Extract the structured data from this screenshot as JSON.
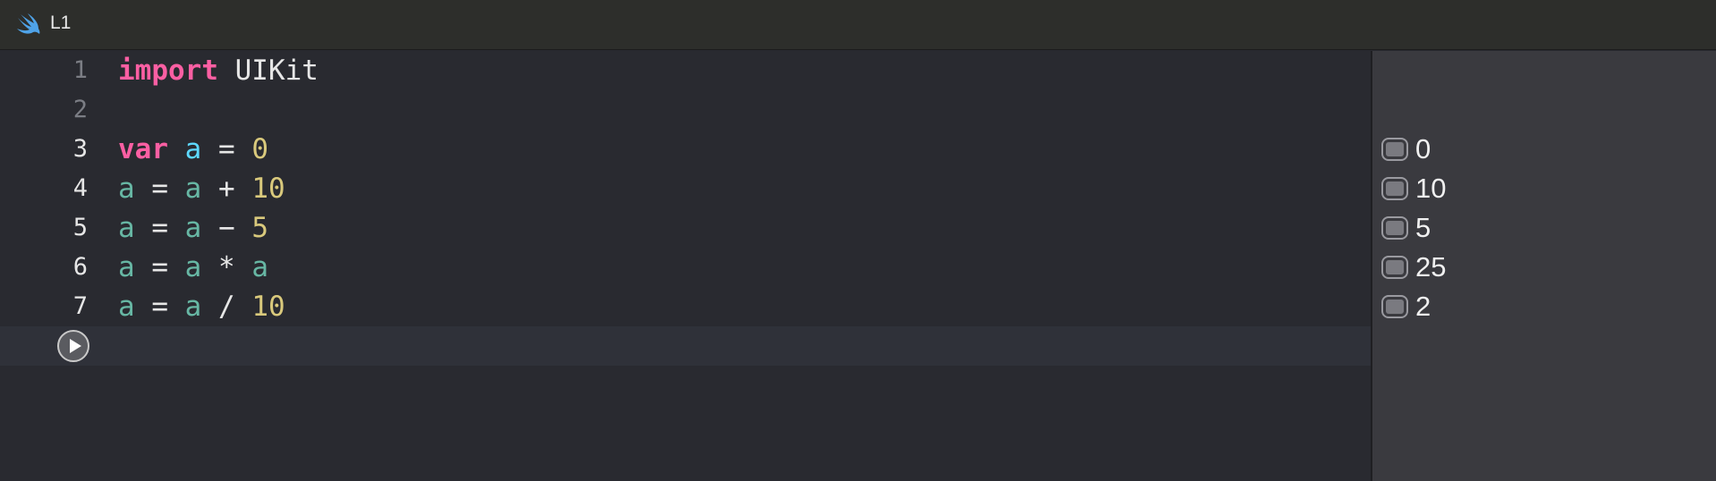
{
  "tab": {
    "icon": "swift-icon",
    "title": "L1"
  },
  "editor": {
    "lines": [
      {
        "number": "1",
        "tokens": [
          {
            "t": "import",
            "c": "kw"
          },
          {
            "t": " UIKit",
            "c": "plain"
          }
        ]
      },
      {
        "number": "2",
        "tokens": []
      },
      {
        "number": "3",
        "tokens": [
          {
            "t": "var",
            "c": "kw"
          },
          {
            "t": " ",
            "c": "plain"
          },
          {
            "t": "a",
            "c": "ident-def"
          },
          {
            "t": " = ",
            "c": "plain"
          },
          {
            "t": "0",
            "c": "num"
          }
        ]
      },
      {
        "number": "4",
        "tokens": [
          {
            "t": "a",
            "c": "ident"
          },
          {
            "t": " = ",
            "c": "plain"
          },
          {
            "t": "a",
            "c": "ident"
          },
          {
            "t": " + ",
            "c": "plain"
          },
          {
            "t": "10",
            "c": "num"
          }
        ]
      },
      {
        "number": "5",
        "tokens": [
          {
            "t": "a",
            "c": "ident"
          },
          {
            "t": " = ",
            "c": "plain"
          },
          {
            "t": "a",
            "c": "ident"
          },
          {
            "t": " − ",
            "c": "plain"
          },
          {
            "t": "5",
            "c": "num"
          }
        ]
      },
      {
        "number": "6",
        "tokens": [
          {
            "t": "a",
            "c": "ident"
          },
          {
            "t": " = ",
            "c": "plain"
          },
          {
            "t": "a",
            "c": "ident"
          },
          {
            "t": " * ",
            "c": "plain"
          },
          {
            "t": "a",
            "c": "ident"
          }
        ]
      },
      {
        "number": "7",
        "tokens": [
          {
            "t": "a",
            "c": "ident"
          },
          {
            "t": " = ",
            "c": "plain"
          },
          {
            "t": "a",
            "c": "ident"
          },
          {
            "t": " / ",
            "c": "plain"
          },
          {
            "t": "10",
            "c": "num"
          }
        ]
      }
    ],
    "run_button_icon": "play-icon"
  },
  "results": [
    {
      "value": "0"
    },
    {
      "value": "10"
    },
    {
      "value": "5"
    },
    {
      "value": "25"
    },
    {
      "value": "2"
    }
  ],
  "colors": {
    "keyword": "#fc5fa3",
    "identifier_declared": "#5dd8ff",
    "identifier": "#67b7a4",
    "number": "#d9c97c",
    "swift_icon": "#4fa3e8"
  }
}
